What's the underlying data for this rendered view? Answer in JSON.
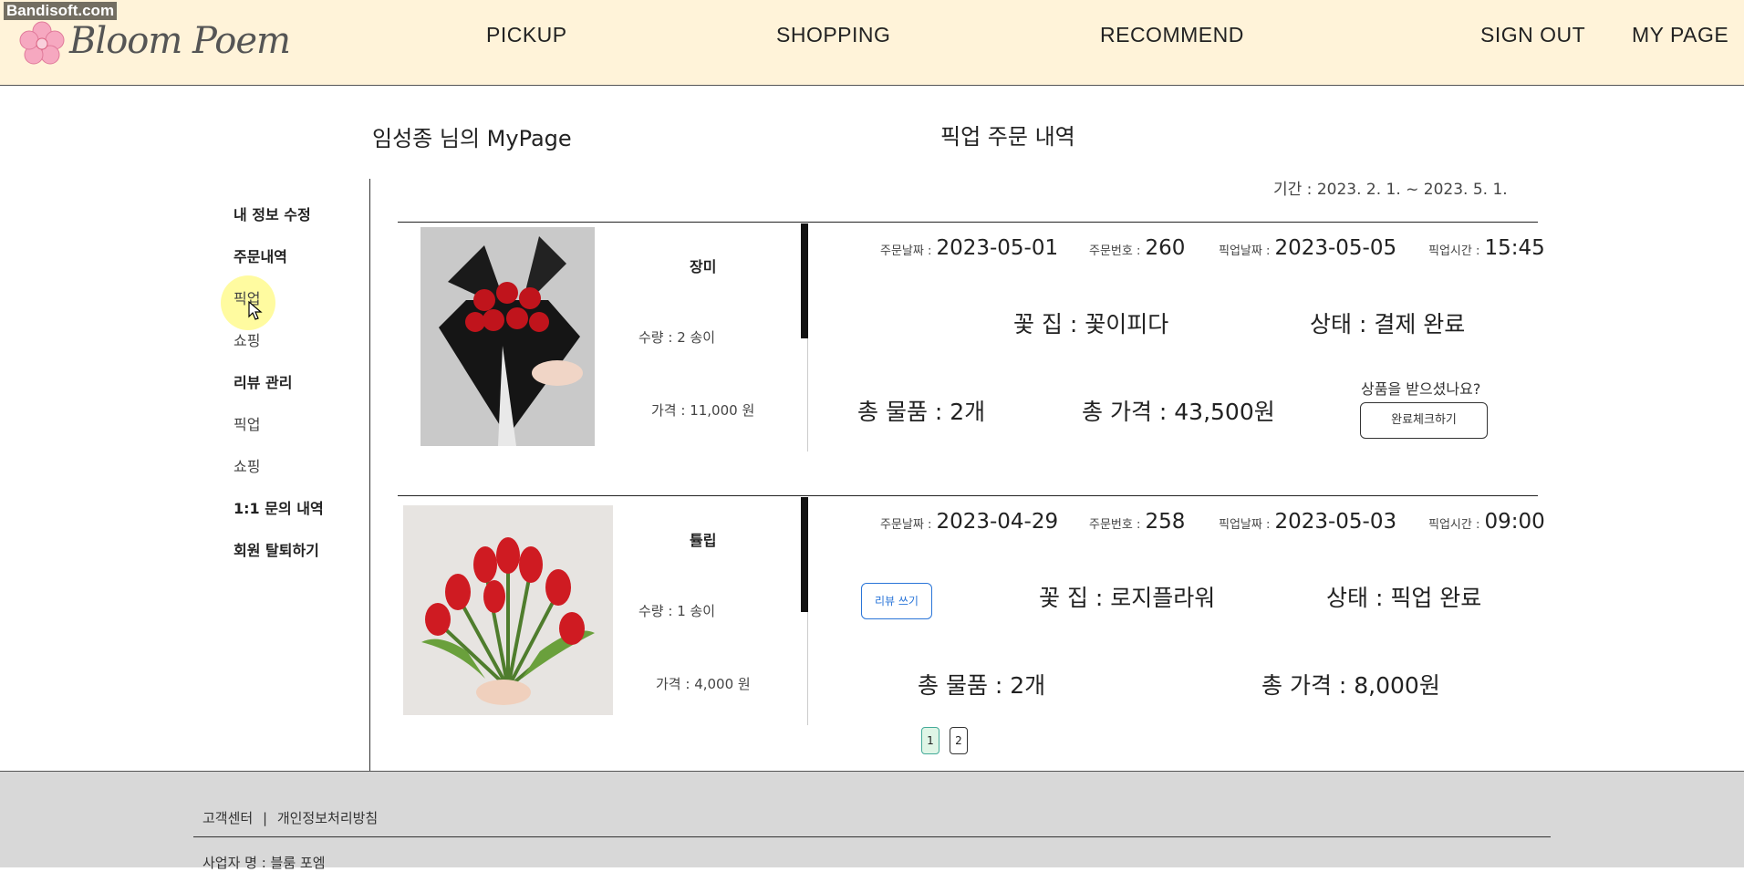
{
  "watermark": "Bandisoft.com",
  "header": {
    "logo_text": "Bloom Poem",
    "nav": [
      "PICKUP",
      "SHOPPING",
      "RECOMMEND"
    ],
    "sign_out": "SIGN OUT",
    "my_page": "MY PAGE"
  },
  "titles": {
    "mypage": "임성종 님의 MyPage",
    "section": "픽업 주문 내역",
    "period": "기간 : 2023. 2. 1. ~ 2023. 5. 1."
  },
  "sidebar": {
    "edit_info": "내 정보 수정",
    "orders": "주문내역",
    "orders_pickup": "픽업",
    "orders_shopping": "쇼핑",
    "reviews": "리뷰 관리",
    "reviews_pickup": "픽업",
    "reviews_shopping": "쇼핑",
    "inquiries": "1:1 문의 내역",
    "withdraw": "회원 탈퇴하기"
  },
  "labels": {
    "order_date": "주문날짜 :",
    "order_no": "주문번호 :",
    "pickup_date": "픽업날짜 :",
    "pickup_time": "픽업시간 :"
  },
  "orders": [
    {
      "product": "장미",
      "qty": "수량 : 2 송이",
      "price": "가격 : 11,000 원",
      "order_date": "2023-05-01",
      "order_no": "260",
      "pickup_date": "2023-05-05",
      "pickup_time": "15:45",
      "shop": "꽃 집 : 꽃이피다",
      "status": "상태 : 결제 완료",
      "total_items": "총 물품 : 2개",
      "total_price": "총 가격 : 43,500원",
      "ask": "상품을 받으셨나요?",
      "done_button": "완료체크하기"
    },
    {
      "product": "튤립",
      "qty": "수량 : 1 송이",
      "price": "가격 : 4,000 원",
      "order_date": "2023-04-29",
      "order_no": "258",
      "pickup_date": "2023-05-03",
      "pickup_time": "09:00",
      "review_button": "리뷰 쓰기",
      "shop": "꽃 집 : 로지플라워",
      "status": "상태 : 픽업 완료",
      "total_items": "총 물품 : 2개",
      "total_price": "총 가격 : 8,000원"
    }
  ],
  "pagination": [
    "1",
    "2"
  ],
  "footer": {
    "customer_center": "고객센터",
    "separator": "|",
    "privacy": "개인정보처리방침",
    "business": "사업자 명 : 블룸 포엠"
  }
}
